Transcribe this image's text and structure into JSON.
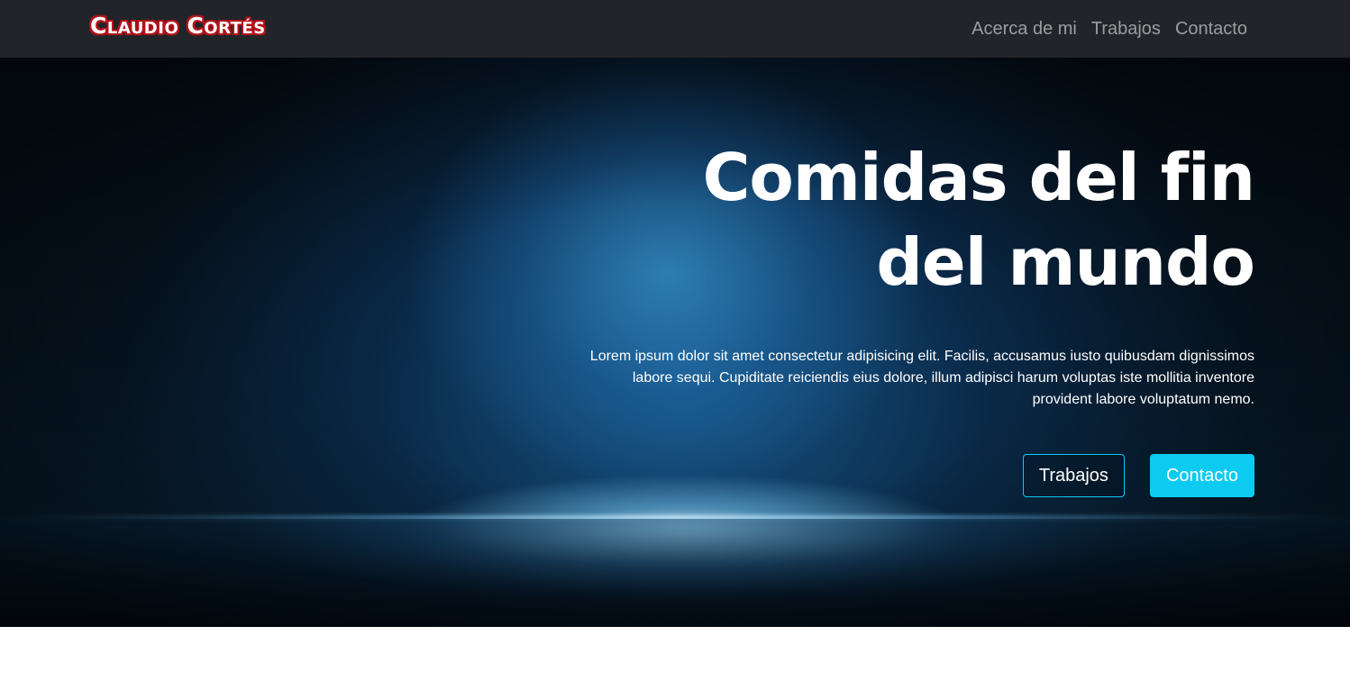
{
  "navbar": {
    "brand": "Claudio Cortés",
    "links": [
      "Acerca de mi",
      "Trabajos",
      "Contacto"
    ]
  },
  "hero": {
    "title_line1": "Comidas del fin",
    "title_line2": "del mundo",
    "text": "Lorem ipsum dolor sit amet consectetur adipisicing elit. Facilis, accusamus iusto quibusdam dignissimos labore sequi. Cupiditate reiciendis eius dolore, illum adipisci harum voluptas iste mollitia inventore provident labore voluptatum nemo.",
    "buttons": {
      "outline_label": "Trabajos",
      "solid_label": "Contacto"
    }
  },
  "colors": {
    "navbar_bg": "#212529",
    "accent": "#0dcaf0",
    "brand_outline": "#b3121a"
  }
}
